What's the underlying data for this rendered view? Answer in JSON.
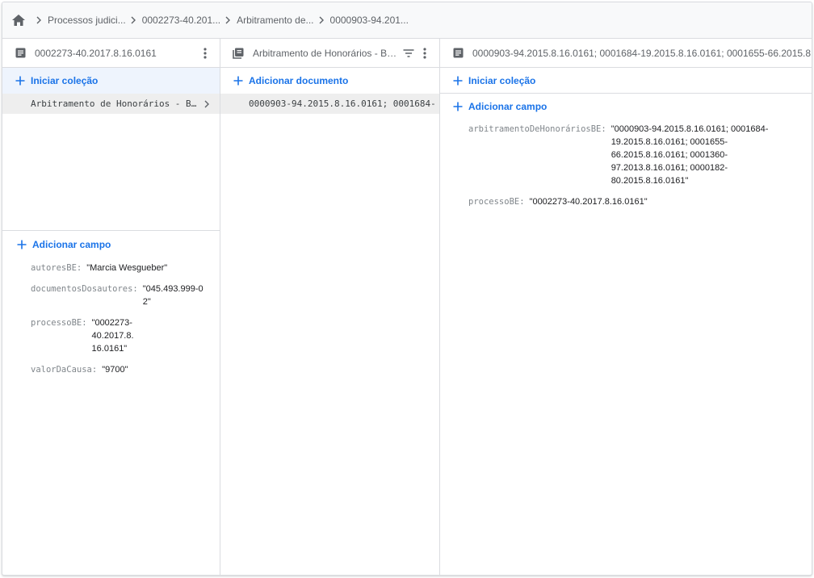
{
  "breadcrumb": {
    "home_icon": "home-icon",
    "items": [
      "Processos judici...",
      "0002273-40.201...",
      "Arbitramento de...",
      "0000903-94.201..."
    ]
  },
  "panel1": {
    "title": "0002273-40.2017.8.16.0161",
    "start_collection": "Iniciar coleção",
    "collections": [
      "Arbitramento de Honorários - B..."
    ],
    "add_field": "Adicionar campo",
    "fields": [
      {
        "key": "autoresBE:",
        "value": "\"Marcia Wesgueber\""
      },
      {
        "key": "documentosDosautores:",
        "value": "\"045.493.999-02\""
      },
      {
        "key": "processoBE:",
        "value": "\"0002273-40.2017.8.16.0161\""
      },
      {
        "key": "valorDaCausa:",
        "value": "\"9700\""
      }
    ]
  },
  "panel2": {
    "title": "Arbitramento de Honorários - Base d...",
    "add_document": "Adicionar documento",
    "documents": [
      "0000903-94.2015.8.16.0161; 0001684-"
    ]
  },
  "panel3": {
    "title": "0000903-94.2015.8.16.0161; 0001684-19.2015.8.16.0161; 0001655-66.2015.8...",
    "start_collection": "Iniciar coleção",
    "add_field": "Adicionar campo",
    "fields": [
      {
        "key": "arbitramentoDeHonoráriosBE:",
        "value": "\"0000903-94.2015.8.16.0161; 0001684-19.2015.8.16.0161; 0001655-66.2015.8.16.0161; 0001360-97.2013.8.16.0161; 0000182-80.2015.8.16.0161\""
      },
      {
        "key": "processoBE:",
        "value": "\"0002273-40.2017.8.16.0161\""
      }
    ]
  },
  "colors": {
    "accent": "#1a73e8",
    "border": "#dadce0",
    "selected_row": "#eeeeee"
  }
}
